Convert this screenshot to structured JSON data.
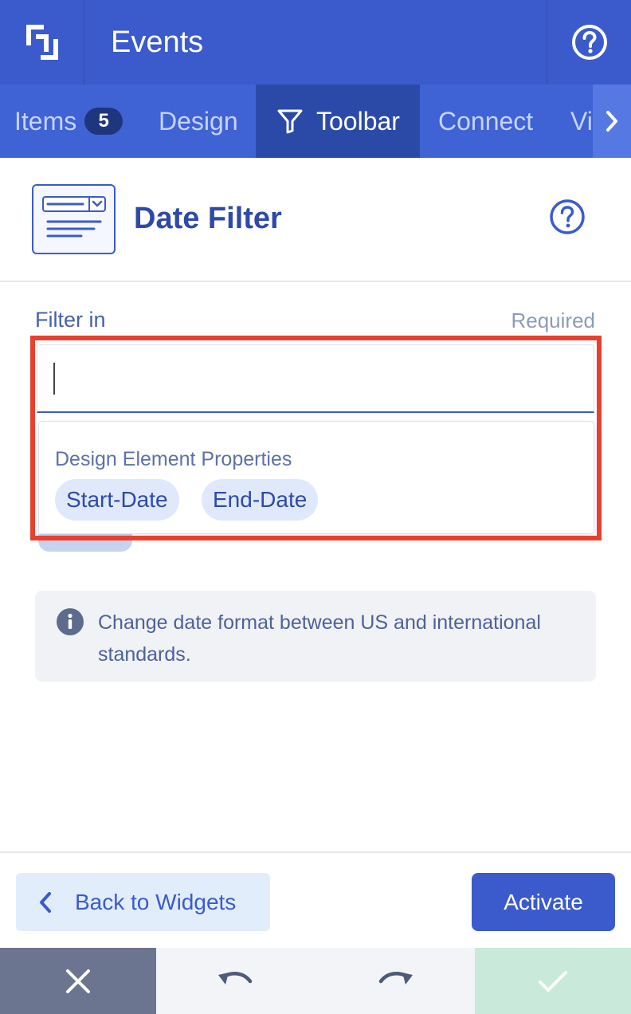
{
  "header": {
    "title": "Events",
    "logo_icon": "app-logo-icon",
    "help_icon": "help-icon"
  },
  "tabs": [
    {
      "label": "Items",
      "badge": "5",
      "active": false
    },
    {
      "label": "Design",
      "active": false
    },
    {
      "label": "Toolbar",
      "icon": "filter-icon",
      "active": true
    },
    {
      "label": "Connect",
      "active": false
    },
    {
      "label": "Vi",
      "active": false
    }
  ],
  "widget": {
    "title": "Date Filter",
    "icon": "date-filter-widget-icon"
  },
  "form": {
    "label": "Filter in",
    "required": "Required",
    "input_value": "",
    "dropdown": {
      "title": "Design Element Properties",
      "options": [
        "Start-Date",
        "End-Date"
      ]
    }
  },
  "info": {
    "text": "Change date format between US and international standards."
  },
  "footer": {
    "back_label": "Back to Widgets",
    "activate_label": "Activate"
  },
  "colors": {
    "primary": "#3b5bcc",
    "highlight": "#e8402e",
    "confirm": "#c9e9da",
    "cancel": "#6b7590"
  }
}
